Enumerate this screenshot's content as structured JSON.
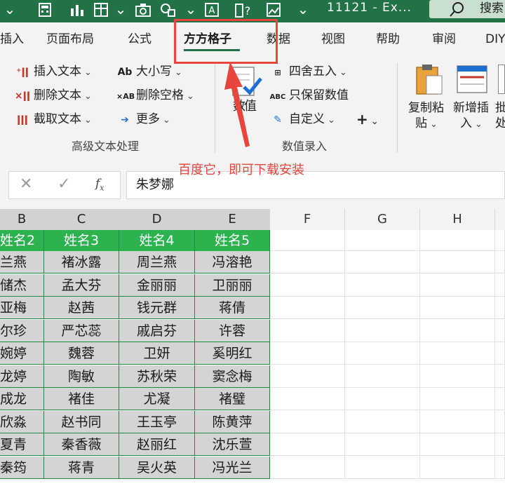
{
  "titlebar": {
    "title": "11121 - Ex...",
    "search_label": "搜索"
  },
  "tabs": [
    "插入",
    "页面布局",
    "公式",
    "方方格子",
    "数据",
    "视图",
    "帮助",
    "审阅",
    "DIY"
  ],
  "active_tab": "方方格子",
  "ribbon": {
    "text_group": {
      "insert_text": "插入文本",
      "delete_text": "删除文本",
      "cut_text": "截取文本",
      "case": "大小写",
      "delete_spaces": "删除空格",
      "more": "更多",
      "label": "高级文本处理"
    },
    "number_group": {
      "big_button_top": "数",
      "big_button_bottom": "值",
      "round": "四舍五入",
      "keep_values": "只保留数值",
      "custom": "自定义",
      "plus": "+",
      "label": "数值录入"
    },
    "right_group": {
      "copy_paste_top": "复制粘",
      "copy_paste_bottom": "贴",
      "new_insert_top": "新增插",
      "new_insert_bottom": "入",
      "batch_top": "批",
      "batch_bottom": "处"
    }
  },
  "formula_bar": {
    "value": "朱梦娜"
  },
  "annotation": "百度它，即可下载安装",
  "columns": [
    "B",
    "C",
    "D",
    "E",
    "F",
    "G",
    "H"
  ],
  "table": {
    "headers": [
      "姓名2",
      "姓名3",
      "姓名4",
      "姓名5"
    ],
    "rows": [
      [
        "兰燕",
        "褚冰露",
        "周兰燕",
        "冯溶艳"
      ],
      [
        "储杰",
        "孟大芬",
        "金丽丽",
        "卫丽丽"
      ],
      [
        "亚梅",
        "赵茜",
        "钱元群",
        "蒋倩"
      ],
      [
        "尔珍",
        "严芯蕊",
        "戚启芬",
        "许蓉"
      ],
      [
        "婉婷",
        "魏蓉",
        "卫妍",
        "奚明红"
      ],
      [
        "龙婷",
        "陶敏",
        "苏秋荣",
        "窦念梅"
      ],
      [
        "成龙",
        "褚佳",
        "尤凝",
        "褚璧"
      ],
      [
        "欣淼",
        "赵书同",
        "王玉亭",
        "陈黄萍"
      ],
      [
        "夏青",
        "秦香薇",
        "赵丽红",
        "沈乐萱"
      ],
      [
        "秦筠",
        "蒋青",
        "吴火英",
        "冯光兰"
      ]
    ]
  },
  "colors": {
    "excel_green": "#217346",
    "header_green": "#2cb34f",
    "highlight_red": "#e8453c",
    "cell_gray": "#d4d4d4"
  }
}
